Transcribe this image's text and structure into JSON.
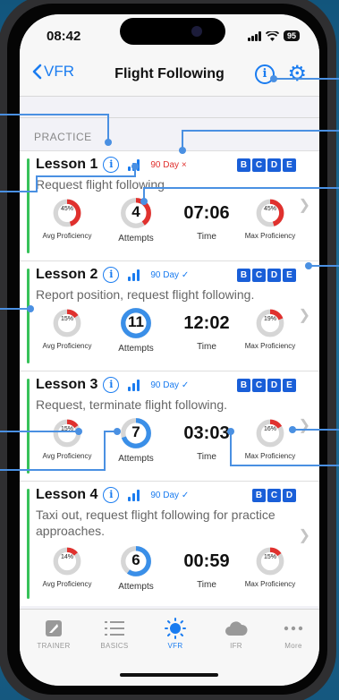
{
  "status": {
    "time": "08:42",
    "battery": "95"
  },
  "nav": {
    "back_label": "VFR",
    "title": "Flight Following",
    "info_symbol": "i",
    "settings_symbol": "⚙"
  },
  "section": {
    "header": "PRACTICE"
  },
  "lessons": [
    {
      "title": "Lesson 1",
      "day_label": "90 Day",
      "day_mark": "×",
      "day_status": "overdue",
      "badges": [
        "B",
        "C",
        "D",
        "E"
      ],
      "description": "Request flight following.",
      "avg_proficiency": "45%",
      "avg_value": 0.45,
      "attempts": "4",
      "attempts_value": 0.4,
      "time": "07:06",
      "max_proficiency": "45%",
      "max_value": 0.45
    },
    {
      "title": "Lesson 2",
      "day_label": "90 Day",
      "day_mark": "✓",
      "day_status": "ok",
      "badges": [
        "B",
        "C",
        "D",
        "E"
      ],
      "description": "Report position, request flight following.",
      "avg_proficiency": "15%",
      "avg_value": 0.15,
      "attempts": "11",
      "attempts_value": 1.0,
      "time": "12:02",
      "max_proficiency": "19%",
      "max_value": 0.19
    },
    {
      "title": "Lesson 3",
      "day_label": "90 Day",
      "day_mark": "✓",
      "day_status": "ok",
      "badges": [
        "B",
        "C",
        "D",
        "E"
      ],
      "description": "Request, terminate flight following.",
      "avg_proficiency": "15%",
      "avg_value": 0.15,
      "attempts": "7",
      "attempts_value": 0.7,
      "time": "03:03",
      "max_proficiency": "16%",
      "max_value": 0.16
    },
    {
      "title": "Lesson 4",
      "day_label": "90 Day",
      "day_mark": "✓",
      "day_status": "ok",
      "badges": [
        "B",
        "C",
        "D"
      ],
      "description": "Taxi out, request flight following for practice approaches.",
      "avg_proficiency": "14%",
      "avg_value": 0.14,
      "attempts": "6",
      "attempts_value": 0.6,
      "time": "00:59",
      "max_proficiency": "15%",
      "max_value": 0.15
    }
  ],
  "stat_labels": {
    "avg": "Avg Proficiency",
    "attempts": "Attempts",
    "time": "Time",
    "max": "Max Proficiency"
  },
  "tabs": [
    {
      "label": "TRAINER",
      "icon": "trainer-icon",
      "active": false
    },
    {
      "label": "BASICS",
      "icon": "list-icon",
      "active": false
    },
    {
      "label": "VFR",
      "icon": "sun-icon",
      "active": true
    },
    {
      "label": "IFR",
      "icon": "cloud-icon",
      "active": false
    },
    {
      "label": "More",
      "icon": "more-icon",
      "active": false
    }
  ],
  "colors": {
    "accent": "#1a7cf0",
    "progress_red": "#e0312e",
    "ring_track": "#d6d6d6",
    "attempts_ring": "#3a8fe8",
    "complete_bar": "#37c25a",
    "badge": "#1a5fd8",
    "callout": "#4a90e2"
  }
}
